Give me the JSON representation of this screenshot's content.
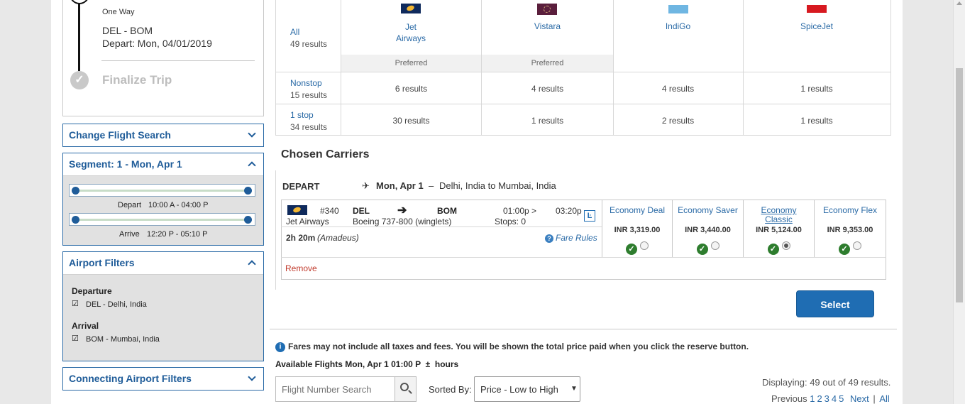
{
  "trip": {
    "type": "One Way",
    "route": "DEL - BOM",
    "depart": "Depart: Mon, 04/01/2019",
    "finalize": "Finalize Trip"
  },
  "sidebar": {
    "change_search": "Change Flight Search",
    "segment": {
      "title": "Segment: 1 - Mon, Apr 1",
      "depart_label": "Depart",
      "depart_range": "10:00 A - 04:00 P",
      "arrive_label": "Arrive",
      "arrive_range": "12:20 P - 05:10 P"
    },
    "airport_filters": {
      "title": "Airport Filters",
      "departure_heading": "Departure",
      "departure_option": "DEL - Delhi, India",
      "arrival_heading": "Arrival",
      "arrival_option": "BOM - Mumbai, India"
    },
    "connecting": "Connecting Airport Filters"
  },
  "matrix": {
    "all_label": "All",
    "all_count": "49 results",
    "carriers": [
      {
        "name": "Jet Airways",
        "name_line1": "Jet",
        "name_line2": "Airways",
        "badge": "Preferred"
      },
      {
        "name": "Vistara",
        "badge": "Preferred"
      },
      {
        "name": "IndiGo"
      },
      {
        "name": "SpiceJet"
      }
    ],
    "rows": [
      {
        "label": "Nonstop",
        "count": "15 results",
        "cells": [
          "6 results",
          "4 results",
          "4 results",
          "1 results"
        ]
      },
      {
        "label": "1 stop",
        "count": "34 results",
        "cells": [
          "30 results",
          "1 results",
          "2 results",
          "1 results"
        ]
      }
    ]
  },
  "chosen": {
    "heading": "Chosen Carriers",
    "depart": "DEPART",
    "date": "Mon, Apr 1",
    "dash": "–",
    "route": "Delhi, India to Mumbai, India",
    "flight": {
      "number": "#340",
      "airline": "Jet Airways",
      "from": "DEL",
      "to": "BOM",
      "aircraft": "Boeing 737-800 (winglets)",
      "dep_time": "01:00p >",
      "arr_time": "03:20p",
      "stops": "Stops: 0",
      "duration": "2h 20m",
      "source": "(Amadeus)",
      "fare_rules": "Fare Rules",
      "remove": "Remove"
    },
    "fares": [
      {
        "name": "Economy Deal",
        "price": "INR 3,319.00",
        "underlined": false,
        "selected": false
      },
      {
        "name": "Economy Saver",
        "price": "INR 3,440.00",
        "underlined": false,
        "selected": false
      },
      {
        "name_line1": "Economy",
        "name_line2": "Classic",
        "price": "INR 5,124.00",
        "underlined": true,
        "selected": true
      },
      {
        "name": "Economy Flex",
        "price": "INR 9,353.00",
        "underlined": false,
        "selected": false
      }
    ],
    "select": "Select"
  },
  "footer": {
    "notice": "Fares may not include all taxes and fees. You will be shown the total price paid when you click the reserve button.",
    "available": "Available Flights Mon, Apr 1 01:00 P  ±  hours",
    "search_placeholder": "Flight Number Search",
    "sorted_by": "Sorted By:",
    "sort_value": "Price - Low to High",
    "displaying": "Displaying: 49 out of 49 results.",
    "pager": {
      "previous": "Previous",
      "pages": [
        "1",
        "2",
        "3",
        "4",
        "5"
      ],
      "next": "Next",
      "sep": "|",
      "all": "All"
    }
  },
  "colors": {
    "accent": "#1f5c99",
    "select_button": "#1f6db3",
    "remove": "#c0392b",
    "check": "#2e7d2e"
  }
}
